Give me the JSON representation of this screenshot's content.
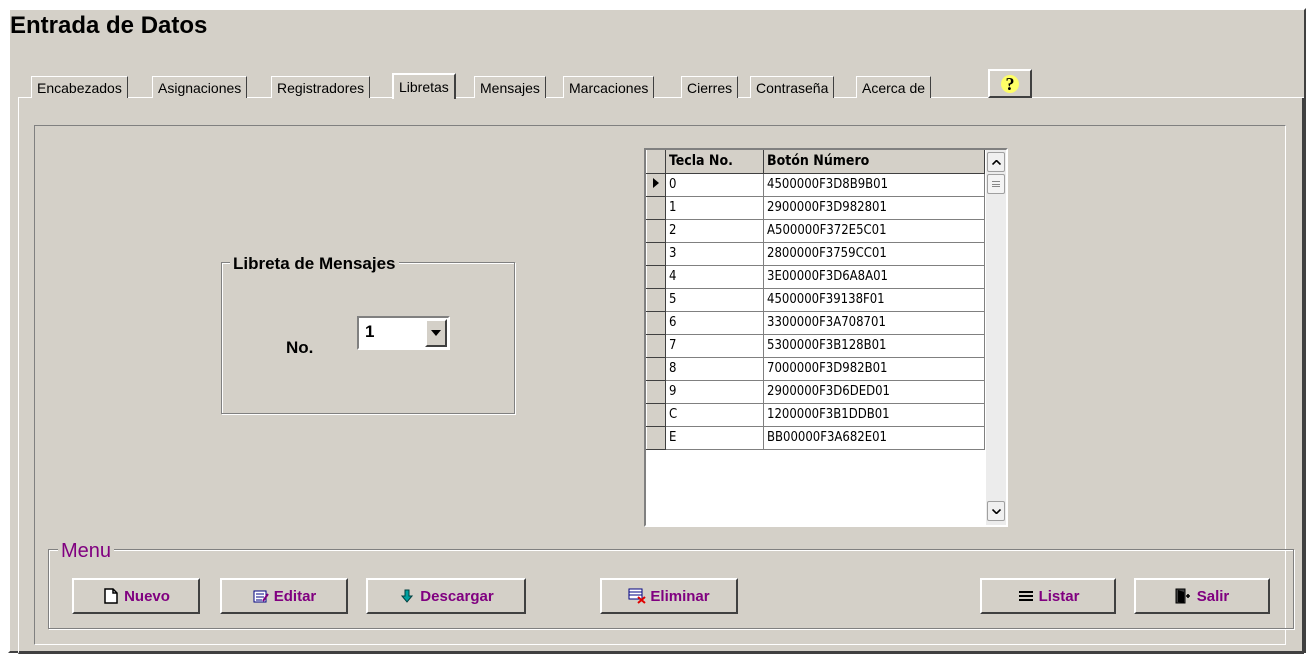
{
  "window": {
    "title": "Entrada de Datos"
  },
  "tabs": [
    {
      "label": "Encabezados",
      "active": false
    },
    {
      "label": "Asignaciones",
      "active": false
    },
    {
      "label": "Registradores",
      "active": false
    },
    {
      "label": "Libretas",
      "active": true
    },
    {
      "label": "Mensajes",
      "active": false
    },
    {
      "label": "Marcaciones",
      "active": false
    },
    {
      "label": "Cierres",
      "active": false
    },
    {
      "label": "Contraseña",
      "active": false
    },
    {
      "label": "Acerca de",
      "active": false
    }
  ],
  "help": {
    "label": "?",
    "icon": "help-question-icon"
  },
  "libreta": {
    "group_title": "Libreta de Mensajes",
    "no_label": "No.",
    "no_value": "1"
  },
  "grid": {
    "columns": [
      "Tecla No.",
      "Botón Número"
    ],
    "rows": [
      {
        "key": "0",
        "value": "4500000F3D8B9B01",
        "current": true
      },
      {
        "key": "1",
        "value": "2900000F3D982801"
      },
      {
        "key": "2",
        "value": "A500000F372E5C01"
      },
      {
        "key": "3",
        "value": "2800000F3759CC01"
      },
      {
        "key": "4",
        "value": "3E00000F3D6A8A01"
      },
      {
        "key": "5",
        "value": "4500000F39138F01"
      },
      {
        "key": "6",
        "value": "3300000F3A708701"
      },
      {
        "key": "7",
        "value": "5300000F3B128B01"
      },
      {
        "key": "8",
        "value": "7000000F3D982B01"
      },
      {
        "key": "9",
        "value": "2900000F3D6DED01"
      },
      {
        "key": "C",
        "value": "1200000F3B1DDB01"
      },
      {
        "key": "E",
        "value": "BB00000F3A682E01"
      }
    ]
  },
  "menu": {
    "title": "Menu",
    "buttons": {
      "nuevo": "Nuevo",
      "editar": "Editar",
      "descargar": "Descargar",
      "eliminar": "Eliminar",
      "listar": "Listar",
      "salir": "Salir"
    }
  }
}
